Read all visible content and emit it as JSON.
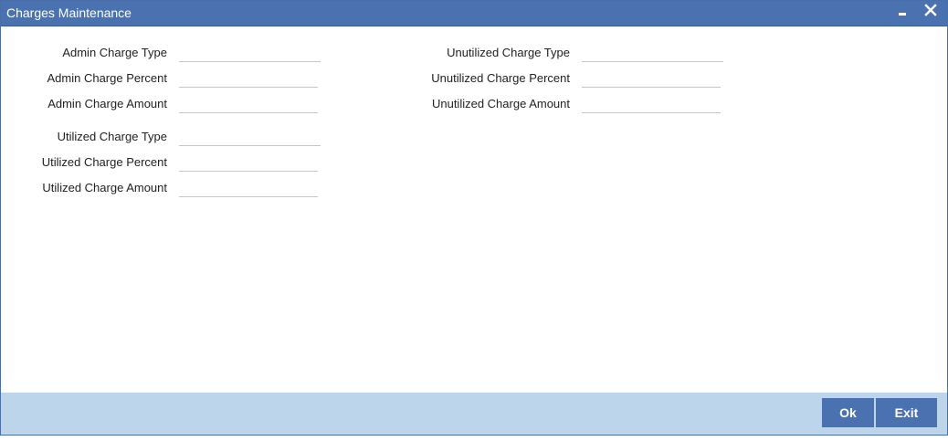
{
  "window": {
    "title": "Charges Maintenance"
  },
  "left_fields": [
    {
      "label": "Admin Charge Type",
      "value": ""
    },
    {
      "label": "Admin Charge Percent",
      "value": ""
    },
    {
      "label": "Admin Charge Amount",
      "value": ""
    },
    {
      "label": "Utilized Charge Type",
      "value": ""
    },
    {
      "label": "Utilized Charge Percent",
      "value": ""
    },
    {
      "label": "Utilized Charge Amount",
      "value": ""
    }
  ],
  "right_fields": [
    {
      "label": "Unutilized Charge Type",
      "value": ""
    },
    {
      "label": "Unutilized Charge Percent",
      "value": ""
    },
    {
      "label": "Unutilized Charge Amount",
      "value": ""
    }
  ],
  "footer": {
    "ok_label": "Ok",
    "exit_label": "Exit"
  },
  "icons": {
    "minimize": "minimize-icon",
    "close": "close-icon"
  },
  "colors": {
    "titlebar": "#4a72b0",
    "footer": "#bcd5ea",
    "button": "#4a72b0"
  }
}
